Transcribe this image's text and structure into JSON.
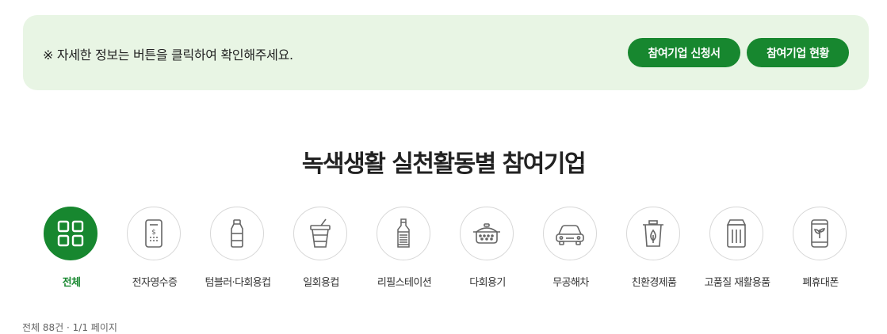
{
  "notice": {
    "text": "※ 자세한 정보는 버튼을 클릭하여 확인해주세요.",
    "apply_button": "참여기업 신청서",
    "status_button": "참여기업 현황"
  },
  "section_title": "녹색생활 실천활동별 참여기업",
  "categories": [
    {
      "label": "전체",
      "icon": "grid-icon",
      "active": true
    },
    {
      "label": "전자영수증",
      "icon": "receipt-icon"
    },
    {
      "label": "텀블러·다회용컵",
      "icon": "tumbler-icon"
    },
    {
      "label": "일회용컵",
      "icon": "disposable-cup-icon"
    },
    {
      "label": "리필스테이션",
      "icon": "refill-bottle-icon"
    },
    {
      "label": "다회용기",
      "icon": "pot-icon"
    },
    {
      "label": "무공해차",
      "icon": "car-icon"
    },
    {
      "label": "친환경제품",
      "icon": "eco-bin-icon"
    },
    {
      "label": "고품질 재활용품",
      "icon": "recycle-box-icon"
    },
    {
      "label": "폐휴대폰",
      "icon": "phone-icon"
    }
  ],
  "count_text": "전체 88건 · 1/1 페이지"
}
